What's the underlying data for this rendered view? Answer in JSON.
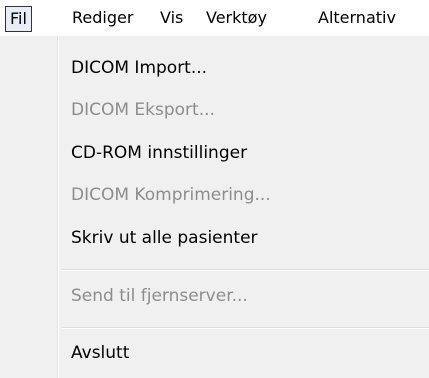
{
  "menubar": {
    "items": [
      {
        "label": "Fil"
      },
      {
        "label": "Rediger"
      },
      {
        "label": "Vis"
      },
      {
        "label": "Verktøy"
      },
      {
        "label": "Alternativ"
      }
    ]
  },
  "file_menu": {
    "items": [
      {
        "label": "DICOM Import...",
        "enabled": true
      },
      {
        "label": "DICOM Eksport...",
        "enabled": false
      },
      {
        "label": "CD-ROM innstillinger",
        "enabled": true
      },
      {
        "label": "DICOM Komprimering...",
        "enabled": false
      },
      {
        "label": "Skriv ut alle pasienter",
        "enabled": true
      },
      {
        "label": "Send til fjernserver...",
        "enabled": false
      },
      {
        "label": "Avslutt",
        "enabled": true
      }
    ]
  }
}
